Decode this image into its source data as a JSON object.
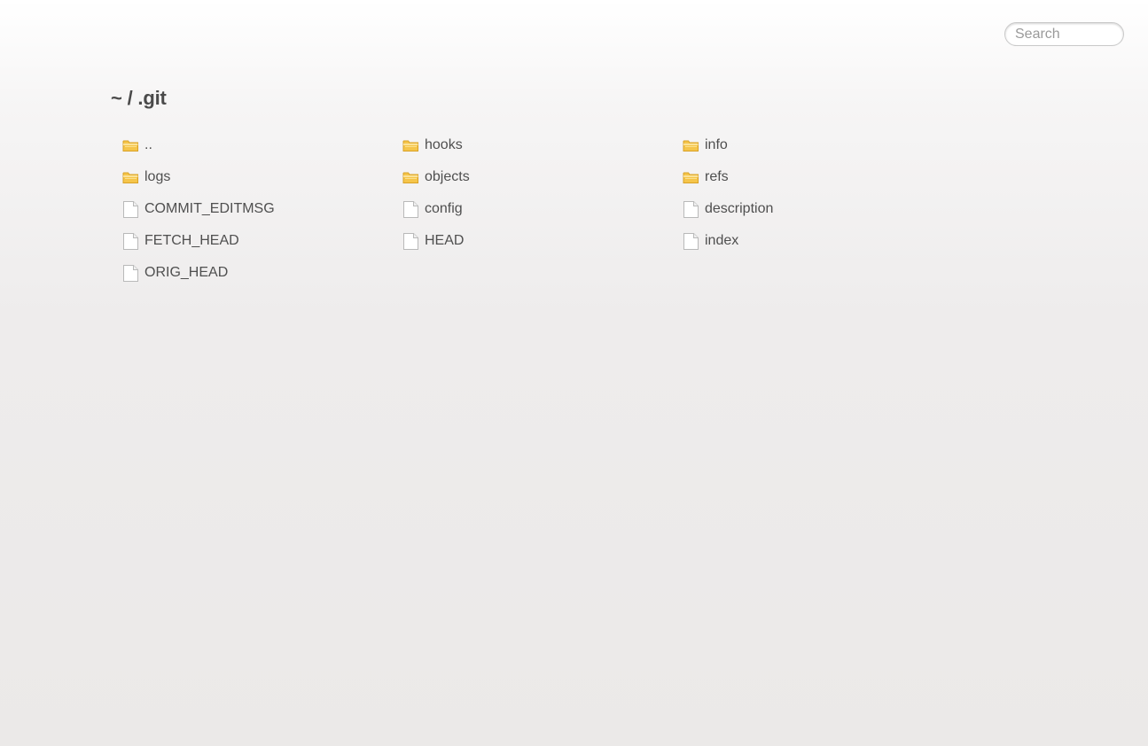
{
  "search": {
    "placeholder": "Search"
  },
  "breadcrumb": {
    "root": "~",
    "separator": "/",
    "current": ".git"
  },
  "entries": [
    {
      "name": "..",
      "type": "folder",
      "icon": "folder-icon"
    },
    {
      "name": "hooks",
      "type": "folder",
      "icon": "folder-icon"
    },
    {
      "name": "info",
      "type": "folder",
      "icon": "folder-icon"
    },
    {
      "name": "logs",
      "type": "folder",
      "icon": "folder-icon"
    },
    {
      "name": "objects",
      "type": "folder",
      "icon": "folder-icon"
    },
    {
      "name": "refs",
      "type": "folder",
      "icon": "folder-icon"
    },
    {
      "name": "COMMIT_EDITMSG",
      "type": "file",
      "icon": "file-icon"
    },
    {
      "name": "config",
      "type": "file",
      "icon": "file-icon"
    },
    {
      "name": "description",
      "type": "file",
      "icon": "file-icon"
    },
    {
      "name": "FETCH_HEAD",
      "type": "file",
      "icon": "file-icon"
    },
    {
      "name": "HEAD",
      "type": "file",
      "icon": "file-icon"
    },
    {
      "name": "index",
      "type": "file",
      "icon": "file-icon"
    },
    {
      "name": "ORIG_HEAD",
      "type": "file",
      "icon": "file-icon"
    }
  ],
  "colors": {
    "folder": "#f5c54a",
    "folder_edge": "#d9a227",
    "file_edge": "#b9b9b9",
    "text": "#4f4f4f"
  }
}
